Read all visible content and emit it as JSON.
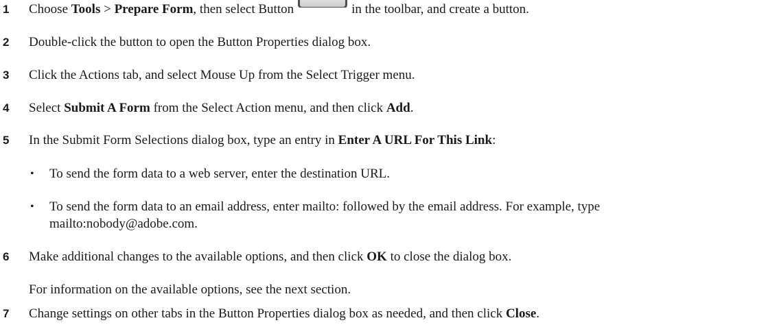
{
  "steps": [
    {
      "number": "1",
      "pre": "Choose ",
      "b1": "Tools",
      "mid1": " > ",
      "b2": "Prepare Form",
      "mid2": ", then select Button",
      "post": "in the toolbar, and create a button.",
      "icon": "button-tool-icon"
    },
    {
      "number": "2",
      "text": "Double-click the button to open the Button Properties dialog box."
    },
    {
      "number": "3",
      "text": "Click the Actions tab, and select Mouse Up from the Select Trigger menu."
    },
    {
      "number": "4",
      "pre": "Select ",
      "b1": "Submit A Form",
      "mid": " from the Select Action menu, and then click ",
      "b2": "Add",
      "post": "."
    },
    {
      "number": "5",
      "pre": "In the Submit Form Selections dialog box, type an entry in ",
      "b1": "Enter A URL For This Link",
      "post": ":",
      "bullets": [
        "To send the form data to a web server, enter the destination URL.",
        "To send the form data to an email address, enter mailto: followed by the email address. For example, type",
        "mailto:nobody@adobe.com."
      ]
    },
    {
      "number": "6",
      "pre": "Make additional changes to the available options, and then click ",
      "b1": "OK",
      "post": " to close the dialog box.",
      "note": "For information on the available options, see the next section."
    },
    {
      "number": "7",
      "pre": "Change settings on other tabs in the Button Properties dialog box as needed, and then click ",
      "b1": "Close",
      "post": "."
    }
  ]
}
